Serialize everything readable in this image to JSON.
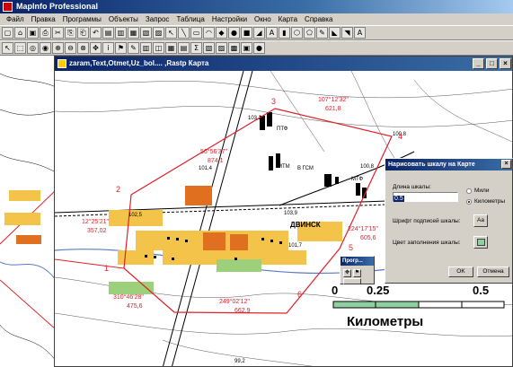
{
  "app": {
    "title": "MapInfo Professional"
  },
  "menubar": [
    "Файл",
    "Правка",
    "Программы",
    "Объекты",
    "Запрос",
    "Таблица",
    "Настройки",
    "Окно",
    "Карта",
    "Справка"
  ],
  "toolbar1": [
    "▢",
    "⌂",
    "▣",
    "⎙",
    "✂",
    "⎘",
    "⎗",
    "↶",
    "▤",
    "▥",
    "▦",
    "▧",
    "▨",
    "↖",
    "╲",
    "▭",
    "◠",
    "◆",
    "●",
    "■",
    "◢",
    "A",
    "▮",
    "⬡",
    "⬠",
    "✎",
    "◣",
    "◥",
    "A"
  ],
  "toolbar2": [
    "↖",
    "⬚",
    "◎",
    "◉",
    "⊕",
    "⊖",
    "⊗",
    "✥",
    "i",
    "⚑",
    "✎",
    "▥",
    "◫",
    "▦",
    "▤",
    "Σ",
    "▧",
    "▨",
    "▩",
    "▣",
    "●"
  ],
  "map_window": {
    "title": "zaram,Text,Otmet,Uz_bol.... ,Rastp Карта"
  },
  "map_labels": {
    "vertices": [
      "3",
      "4",
      "2",
      "1",
      "6",
      "5"
    ],
    "coords": [
      {
        "deg": "107°12'32\"",
        "dist": "621,8"
      },
      {
        "deg": "56°56'37\"",
        "dist": "874,1"
      },
      {
        "deg": "12°25'21\"",
        "dist": "357,02"
      },
      {
        "deg": "224°17'15\"",
        "dist": "605,6"
      },
      {
        "deg": "310°46'28\"",
        "dist": "475,6"
      },
      {
        "deg": "249°02'12\"",
        "dist": "662,9"
      }
    ],
    "place": "ДВИНСК",
    "spot_heights": [
      "100,8",
      "103,2",
      "101,4",
      "102,5",
      "101,7",
      "103,9",
      "99,2",
      "100,8"
    ],
    "buildings": [
      "ПТФ",
      "МТМ",
      "В ГСМ",
      "МТФ"
    ]
  },
  "scale_dialog": {
    "title": "Нарисовать шкалу на Карте",
    "length_label": "Длина шкалы:",
    "length_value": "0.5",
    "unit_miles": "Мили",
    "unit_km": "Километры",
    "font_label": "Шрифт подписей шкалы:",
    "font_btn": "Аа",
    "fill_label": "Цвет заполнения шкалы:",
    "ok": "OK",
    "cancel": "Отмена"
  },
  "mini_dialog": {
    "title": "Прогр..."
  },
  "scalebar": {
    "ticks": [
      "0",
      "0.25",
      "0.5"
    ],
    "unit": "Километры"
  },
  "colors": {
    "title_blue": "#0a246a",
    "polygon_red": "#e0202a",
    "settlement_orange": "#f4c44a",
    "settlement_dark": "#e07020",
    "river_blue": "#5a7ac8"
  }
}
